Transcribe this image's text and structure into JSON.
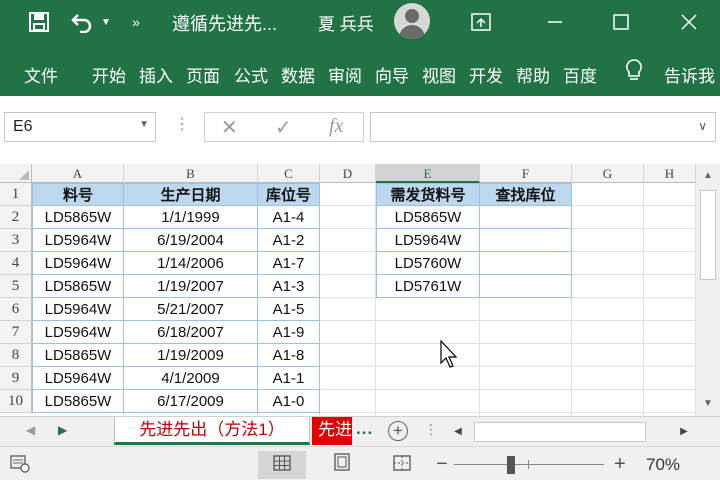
{
  "window": {
    "title": "遵循先进先...",
    "user": "夏 兵兵",
    "brand_color": "#217346"
  },
  "titlebar_icons": [
    "save-icon",
    "undo-icon",
    "dropdown-icon",
    "more-icon",
    "ribbon-display-icon",
    "minimize-icon",
    "maximize-icon",
    "close-icon"
  ],
  "ribbon": {
    "tabs": [
      "文件",
      "开始",
      "插入",
      "页面",
      "公式",
      "数据",
      "审阅",
      "向导",
      "视图",
      "开发",
      "帮助",
      "百度",
      "告诉我"
    ],
    "lightbulb_icon": "lightbulb-icon"
  },
  "formula_bar": {
    "name_box": "E6",
    "cancel_glyph": "✕",
    "enter_glyph": "✓",
    "fx_glyph": "fx",
    "formula": ""
  },
  "columns": [
    "A",
    "B",
    "C",
    "D",
    "E",
    "F",
    "G",
    "H"
  ],
  "rows": [
    "1",
    "2",
    "3",
    "4",
    "5",
    "6",
    "7",
    "8",
    "9",
    "10"
  ],
  "table_left": {
    "headers": [
      "料号",
      "生产日期",
      "库位号"
    ],
    "rows": [
      [
        "LD5865W",
        "1/1/1999",
        "A1-4"
      ],
      [
        "LD5964W",
        "6/19/2004",
        "A1-2"
      ],
      [
        "LD5964W",
        "1/14/2006",
        "A1-7"
      ],
      [
        "LD5865W",
        "1/19/2007",
        "A1-3"
      ],
      [
        "LD5964W",
        "5/21/2007",
        "A1-5"
      ],
      [
        "LD5964W",
        "6/18/2007",
        "A1-9"
      ],
      [
        "LD5865W",
        "1/19/2009",
        "A1-8"
      ],
      [
        "LD5964W",
        "4/1/2009",
        "A1-1"
      ],
      [
        "LD5865W",
        "6/17/2009",
        "A1-0"
      ]
    ]
  },
  "table_right": {
    "headers": [
      "需发货料号",
      "查找库位"
    ],
    "rows": [
      [
        "LD5865W",
        ""
      ],
      [
        "LD5964W",
        ""
      ],
      [
        "LD5760W",
        ""
      ],
      [
        "LD5761W",
        ""
      ]
    ]
  },
  "sheets": {
    "active": "先进先出（方法1）",
    "second": "先进",
    "more": "...",
    "add": "+"
  },
  "status": {
    "zoom": "70%",
    "zoom_minus": "−",
    "zoom_plus": "+"
  }
}
